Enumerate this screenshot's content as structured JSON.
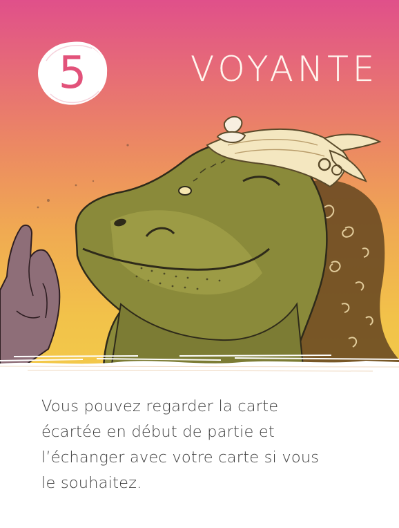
{
  "card": {
    "number": "5",
    "title": "VOYANTE",
    "description_lines": [
      "Vous pouvez regarder la carte",
      "écartée en début de partie et",
      "l’échanger avec votre carte si vous",
      "le souhaitez."
    ],
    "illustration": "crocodile-fortune-teller-with-headscarf",
    "colors": {
      "gradient_top": "#e0508a",
      "gradient_bottom": "#f3c94a",
      "number": "#e2527a",
      "title": "#fff6ef",
      "text": "#3d3d3d",
      "creature_skin": "#8a8a3a"
    }
  }
}
